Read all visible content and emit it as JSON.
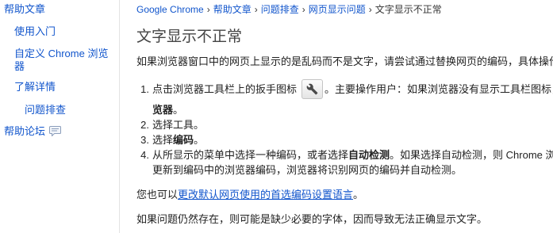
{
  "theme": {
    "link_color": "#1155cc",
    "text_color": "#222222",
    "title_color": "#444444",
    "divider_color": "#e3e3e3"
  },
  "sidebar": {
    "help_articles": "帮助文章",
    "getting_started": "使用入门",
    "customize_chrome": "自定义 Chrome 浏览器",
    "learn_more": "了解详情",
    "troubleshooting": "问题排查",
    "help_forum": "帮助论坛",
    "help_forum_icon": "speech-bubble-icon"
  },
  "breadcrumb": {
    "links": [
      "Google Chrome",
      "帮助文章",
      "问题排查",
      "网页显示问题"
    ],
    "separator": "›",
    "current": "文字显示不正常"
  },
  "article": {
    "title": "文字显示不正常",
    "intro": "如果浏览器窗口中的网页上显示的是乱码而不是文字，请尝试通过替换网页的编码，具体操作步骤如",
    "steps": [
      {
        "number": "1.",
        "text_before_icon": "点击浏览器工具栏上的扳手图标",
        "icon": "wrench-icon",
        "text_after_icon": "。主要操作用户：如果浏览器没有显示工具栏图标，请",
        "continuation_bold": "览器",
        "continuation_after": "。"
      },
      {
        "number": "2.",
        "text": "选择工具。"
      },
      {
        "number": "3.",
        "text_before": "选择",
        "bold": "编码",
        "text_after": "。"
      },
      {
        "number": "4.",
        "text_before": "从所显示的菜单中选择一种编码，或者选择",
        "bold": "自动检测",
        "text_after": "。如果选择自动检测，则 Chrome 浏览",
        "continuation": "更新到编码中的浏览器编码，浏览器将识别网页的编码并自动检测。"
      }
    ],
    "encoding_note": {
      "prefix": "您也可以",
      "link": "更改默认网页使用的首选编码设置语言",
      "suffix": "。"
    },
    "closing": "如果问题仍然存在，则可能是缺少必要的字体，因而导致无法正确显示文字。"
  }
}
